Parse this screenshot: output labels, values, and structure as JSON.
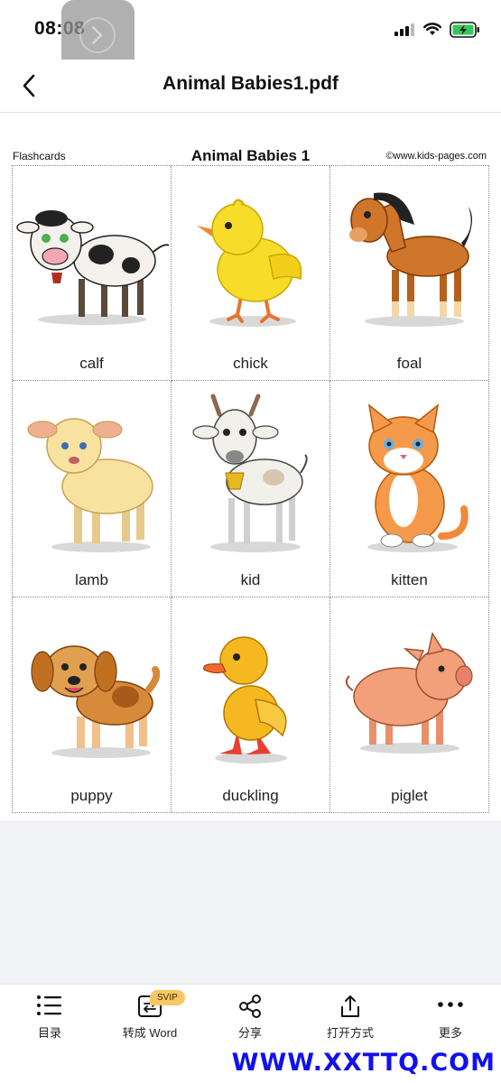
{
  "status_bar": {
    "time": "08:08"
  },
  "nav": {
    "title": "Animal Babies1.pdf"
  },
  "page": {
    "header_left": "Flashcards",
    "header_title": "Animal Babies 1",
    "header_right": "©www.kids-pages.com",
    "cards": [
      {
        "label": "calf"
      },
      {
        "label": "chick"
      },
      {
        "label": "foal"
      },
      {
        "label": "lamb"
      },
      {
        "label": "kid"
      },
      {
        "label": "kitten"
      },
      {
        "label": "puppy"
      },
      {
        "label": "duckling"
      },
      {
        "label": "piglet"
      }
    ]
  },
  "toolbar": {
    "items": [
      {
        "label": "目录",
        "icon": "list-icon"
      },
      {
        "label": "转成 Word",
        "icon": "convert-word-icon",
        "badge": "SVIP"
      },
      {
        "label": "分享",
        "icon": "share-icon"
      },
      {
        "label": "打开方式",
        "icon": "open-with-icon"
      },
      {
        "label": "更多",
        "icon": "more-icon"
      }
    ]
  },
  "watermark": "WWW.XXTTQ.COM",
  "colors": {
    "accent_badge": "#f6c667",
    "watermark": "#1111ee",
    "battery": "#34c759"
  }
}
